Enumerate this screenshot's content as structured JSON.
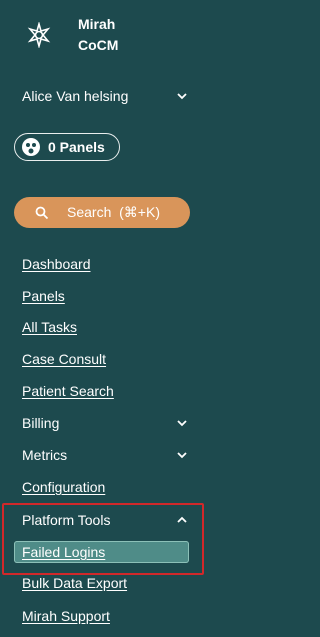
{
  "brand": {
    "name_line1": "Mirah",
    "name_line2": "CoCM"
  },
  "user": {
    "name": "Alice Van helsing"
  },
  "panels": {
    "label": "0 Panels"
  },
  "search": {
    "label": "Search  (⌘+K)"
  },
  "nav": {
    "dashboard": "Dashboard",
    "panels": "Panels",
    "all_tasks": "All Tasks",
    "case_consult": "Case Consult",
    "patient_search": "Patient Search",
    "billing": "Billing",
    "metrics": "Metrics",
    "configuration": "Configuration",
    "platform_tools": "Platform Tools",
    "failed_logins": "Failed Logins",
    "bulk_data_export": "Bulk Data Export",
    "mirah_support": "Mirah Support"
  },
  "colors": {
    "background": "#1d4a4e",
    "accent": "#d9955a",
    "active": "#4f8c88",
    "highlight": "#d2282a"
  }
}
